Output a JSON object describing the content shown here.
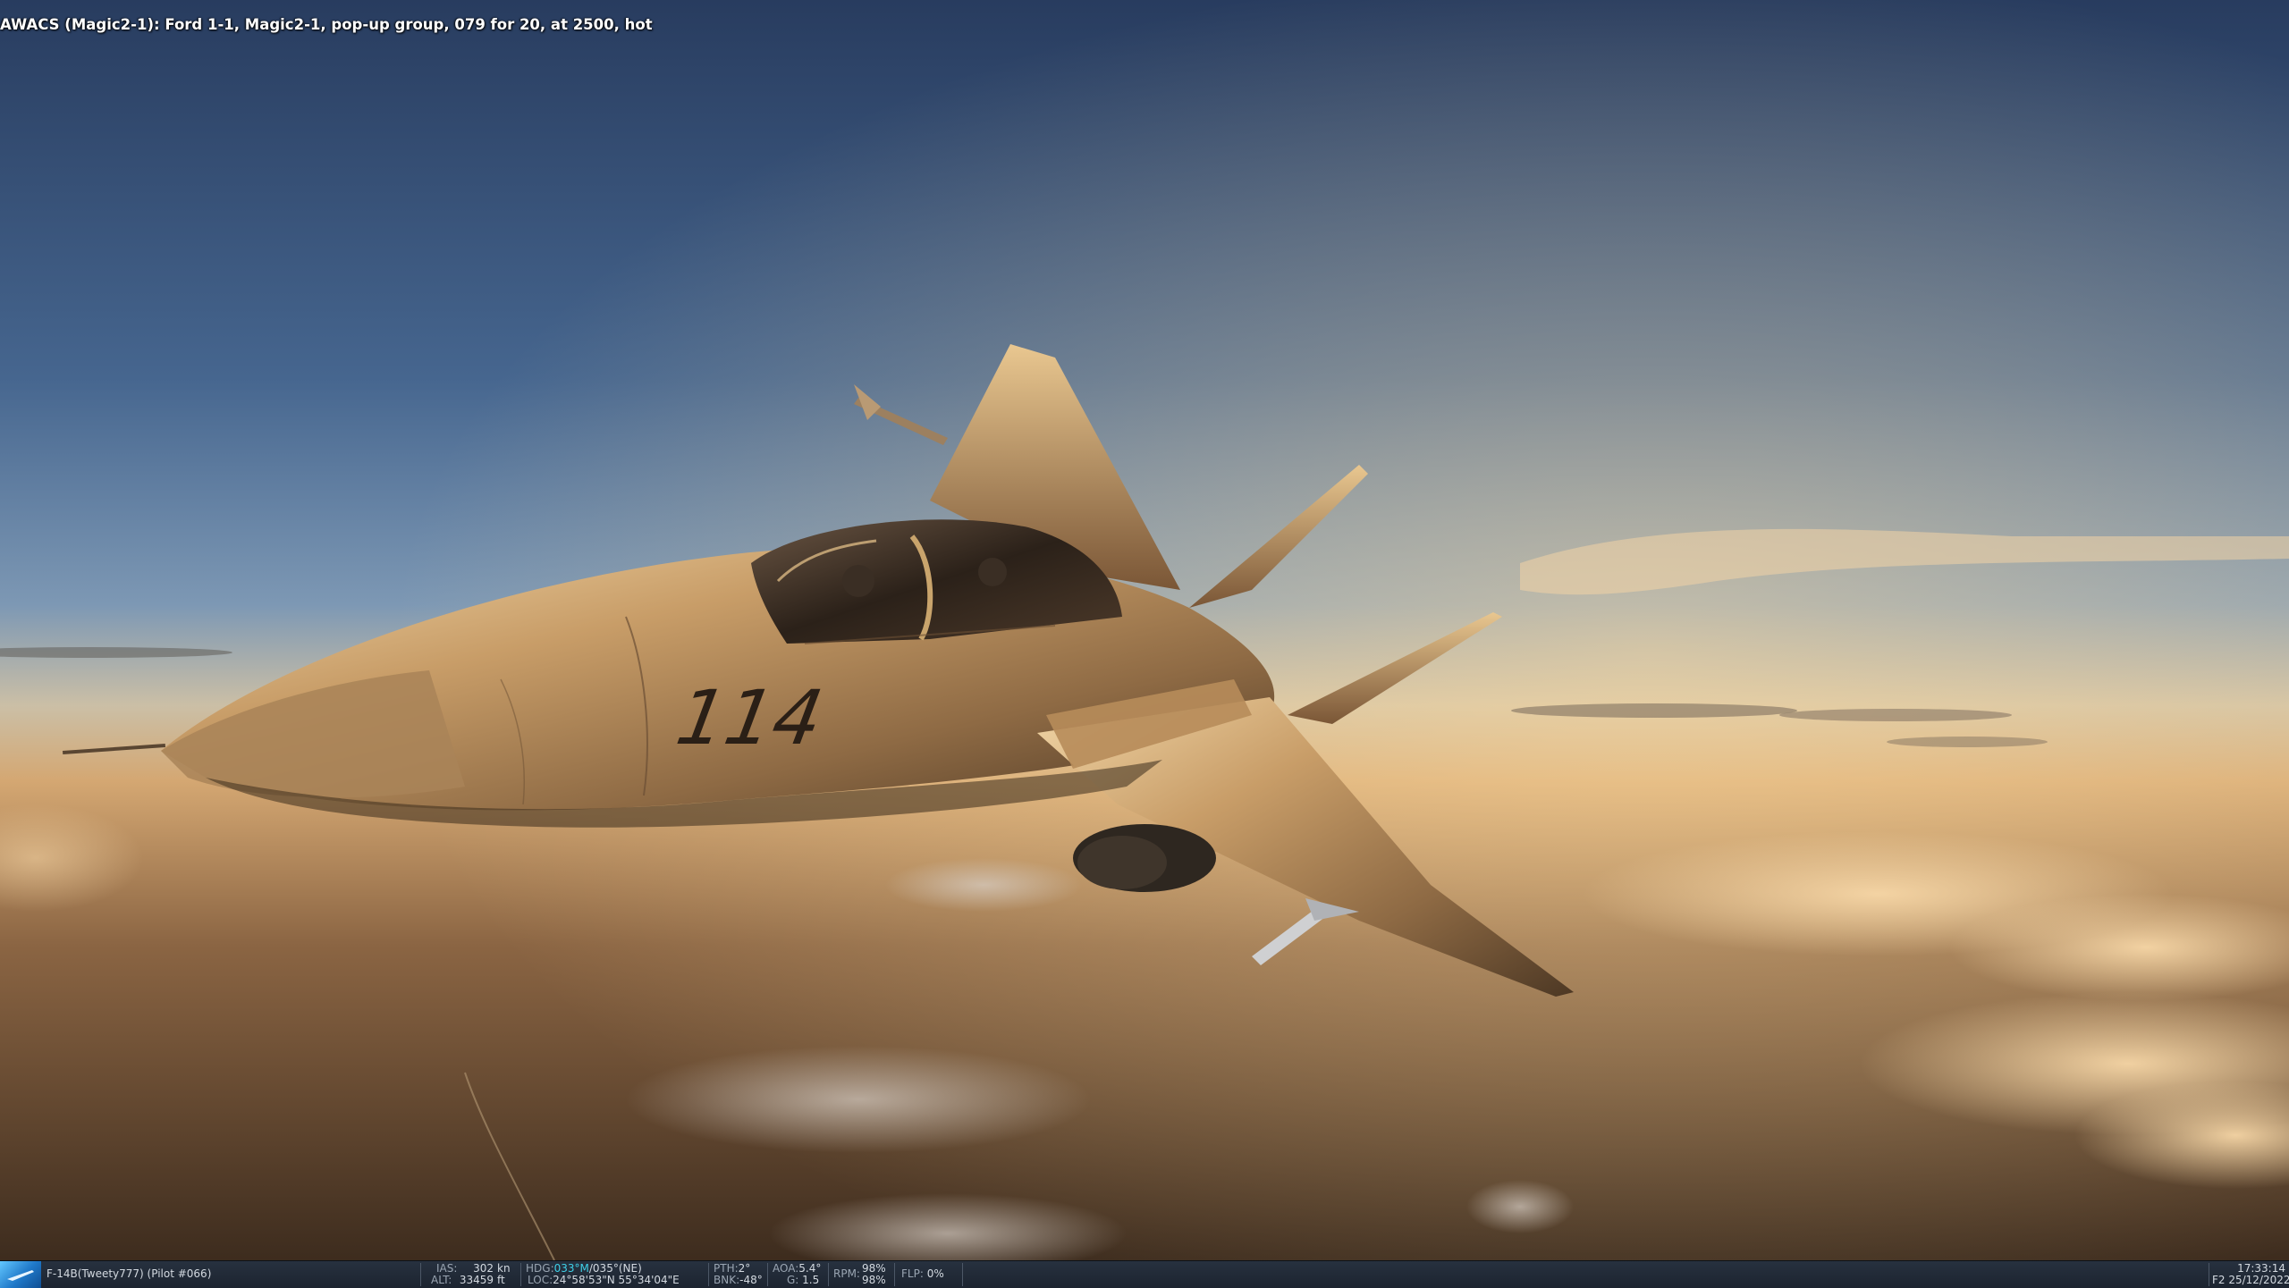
{
  "radio_message": "AWACS (Magic2-1): Ford 1-1, Magic2-1, pop-up group, 079 for 20, at 2500, hot",
  "aircraft": {
    "side_number": "114"
  },
  "status_bar": {
    "unit": "F-14B(Tweety777) (Pilot #066)",
    "ias_label": "IAS:",
    "ias_value": "302",
    "ias_unit": "kn",
    "alt_label": "ALT:",
    "alt_value": "33459",
    "alt_unit": "ft",
    "hdg_label": "HDG:",
    "hdg_magnetic": "033°M",
    "hdg_rest": "/035°(NE)",
    "loc_label": "LOC:",
    "loc_value": "24°58'53\"N 55°34'04\"E",
    "pth_label": "PTH:",
    "pth_value": "2°",
    "bnk_label": "BNK:",
    "bnk_value": "-48°",
    "aoa_label": "AOA:",
    "aoa_value": "5.4°",
    "g_label": "G:",
    "g_value": "1.5",
    "rpm_label": "RPM:",
    "rpm_left": "98%",
    "rpm_right": "98%",
    "flp_label": "FLP:",
    "flp_value": "0%",
    "time": "17:33:14",
    "date": "F2 25/12/2022"
  },
  "colors": {
    "accent": "#3fd0e8",
    "sky_top": "#2b4064",
    "horizon": "#e8c792",
    "ground": "#4a3624"
  }
}
